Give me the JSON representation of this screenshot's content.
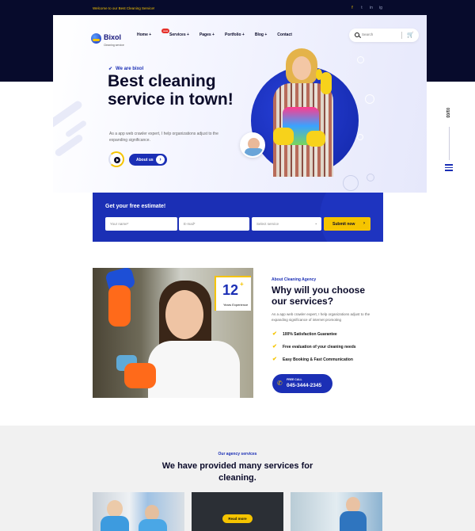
{
  "topbar": {
    "welcome": "Welcome to our Best Cleaning Service!",
    "social": [
      "f",
      "t",
      "in",
      "ig"
    ]
  },
  "logo": {
    "name": "Bixol",
    "tagline": "Cleaning service"
  },
  "nav": {
    "items": [
      "Home +",
      "Services +",
      "Pages +",
      "Portfolio +",
      "Blog +",
      "Contact"
    ],
    "new_badge": "new",
    "search_placeholder": "Search"
  },
  "hero": {
    "tagline": "We are bixol",
    "headline": "Best cleaning service in town!",
    "description": "As a app web crawler expert, I help organizations adjust to the expanding significance.",
    "about_button": "About us"
  },
  "side": {
    "slide_counter": "01/03"
  },
  "estimate": {
    "title": "Get your free estimate!",
    "name_placeholder": "Your name*",
    "email_placeholder": "E-mail*",
    "service_placeholder": "Select service",
    "submit": "Submit now"
  },
  "about": {
    "years": "12",
    "years_label": "Years Experience",
    "subtitle": "About Cleaning Agency",
    "title": "Why will you choose our services?",
    "description": "As a app web crawler expert, I help organizations adjust to the expanding significance of internet promoting",
    "features": [
      "100% Satisfaction Guarantee",
      "Free evaluation of your cleaning needs",
      "Easy Booking & Fast Communication"
    ],
    "call_label": "FREE CALL",
    "call_number": "045-3444-2345"
  },
  "services": {
    "subtitle": "Our agency services",
    "title": "We have provided many services for cleaning.",
    "read_more": "Read more"
  },
  "colors": {
    "primary": "#1b2fb5",
    "accent": "#f5c400",
    "dark": "#070b2c"
  }
}
